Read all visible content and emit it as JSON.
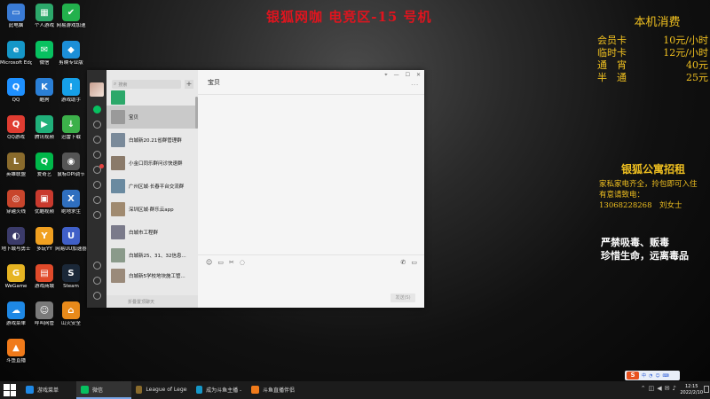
{
  "banner": "银狐网咖 电竞区-15 号机",
  "desktop_icons": [
    {
      "label": "此电脑",
      "icon": "computer-icon",
      "color": "#3a7bd5",
      "glyph": "▭"
    },
    {
      "label": "个人游戏",
      "icon": "games-folder-icon",
      "color": "#2ca86a",
      "glyph": "▦"
    },
    {
      "label": "网易游戏加速",
      "icon": "game-accelerator-icon",
      "color": "#22b14c",
      "glyph": "✔"
    },
    {
      "label": "Microsoft Edge浏览器",
      "icon": "edge-browser-icon",
      "color": "#1597c8",
      "glyph": "e"
    },
    {
      "label": "微信",
      "icon": "wechat-icon",
      "color": "#07c160",
      "glyph": "✉"
    },
    {
      "label": "剪映专业版",
      "icon": "capcut-icon",
      "color": "#1c8fd8",
      "glyph": "◆"
    },
    {
      "label": "QQ",
      "icon": "qq-icon",
      "color": "#1e90ff",
      "glyph": "Q"
    },
    {
      "label": "酷狗",
      "icon": "kugou-icon",
      "color": "#2a7fd6",
      "glyph": "K"
    },
    {
      "label": "游戏助手",
      "icon": "game-helper-icon",
      "color": "#16a0e8",
      "glyph": "!"
    },
    {
      "label": "QQ游戏",
      "icon": "qq-games-icon",
      "color": "#e03c31",
      "glyph": "Q"
    },
    {
      "label": "腾讯视频",
      "icon": "tencent-video-icon",
      "color": "#20b07a",
      "glyph": "▶"
    },
    {
      "label": "迅雷下载",
      "icon": "download-icon",
      "color": "#3cb04a",
      "glyph": "↓"
    },
    {
      "label": "英雄联盟",
      "icon": "league-of-legends-icon",
      "color": "#8a6b2c",
      "glyph": "L"
    },
    {
      "label": "爱奇艺",
      "icon": "iqiyi-icon",
      "color": "#00b84a",
      "glyph": "Q"
    },
    {
      "label": "鼠标DPI调节",
      "icon": "mouse-icon",
      "color": "#555555",
      "glyph": "◉"
    },
    {
      "label": "穿越火线",
      "icon": "crossfire-icon",
      "color": "#c8452c",
      "glyph": "◎"
    },
    {
      "label": "优酷视频",
      "icon": "youku-icon",
      "color": "#c93a2e",
      "glyph": "▣"
    },
    {
      "label": "绝地求生",
      "icon": "pubg-icon",
      "color": "#2f6fbf",
      "glyph": "X"
    },
    {
      "label": "地下城与勇士",
      "icon": "dnf-icon",
      "color": "#3b3b6a",
      "glyph": "◐"
    },
    {
      "label": "多玩YY",
      "icon": "yy-icon",
      "color": "#f0a020",
      "glyph": "Y"
    },
    {
      "label": "网易UU加速器",
      "icon": "uu-booster-icon",
      "color": "#4060c8",
      "glyph": "U"
    },
    {
      "label": "WeGame",
      "icon": "wegame-icon",
      "color": "#e6b422",
      "glyph": "G"
    },
    {
      "label": "游戏商城",
      "icon": "game-store-icon",
      "color": "#e04a2a",
      "glyph": "▤"
    },
    {
      "label": "Steam",
      "icon": "steam-icon",
      "color": "#1b2838",
      "glyph": "S"
    },
    {
      "label": "游戏菜单",
      "icon": "game-menu-icon",
      "color": "#1e88e5",
      "glyph": "☁"
    },
    {
      "label": "呼叫网管",
      "icon": "call-admin-icon",
      "color": "#7a7a7a",
      "glyph": "☺"
    },
    {
      "label": "山火安全",
      "icon": "security-icon",
      "color": "#e88a1a",
      "glyph": "⌂"
    },
    {
      "label": "斗鱼直播",
      "icon": "douyu-icon",
      "color": "#f07a1a",
      "glyph": "▲"
    }
  ],
  "pricing": {
    "title": "本机消费",
    "rows": [
      {
        "name": "会员卡",
        "price": "10元/小时"
      },
      {
        "name": "临时卡",
        "price": "12元/小时"
      },
      {
        "name": "通　宵",
        "price": "40元"
      },
      {
        "name": "半　通",
        "price": "25元"
      }
    ]
  },
  "rent": {
    "title": "银狐公寓招租",
    "lines": [
      "家私家电齐全，拎包即可入住",
      "有意请致电：",
      "13068228268　刘女士"
    ]
  },
  "warning": [
    "严禁吸毒、贩毒",
    "珍惜生命，远离毒品"
  ],
  "wechat": {
    "search_placeholder": "搜索",
    "add_label": "+",
    "conversations": [
      {
        "name": "",
        "time": "",
        "color": "#2ca86a"
      },
      {
        "name": "宝贝",
        "time": "",
        "color": "#9a9a9a"
      },
      {
        "name": "白城新20.21省群管理群",
        "time": "",
        "color": "#7a8a9a"
      },
      {
        "name": "小金口同乐群问诊快速群",
        "time": "",
        "color": "#8a7a6a"
      },
      {
        "name": "广州区城·长春平台交流群",
        "time": "",
        "color": "#6a8aa0"
      },
      {
        "name": "深圳区城·群乐云app",
        "time": "",
        "color": "#a08a70"
      },
      {
        "name": "白城市工程群",
        "time": "",
        "color": "#7a7a8a"
      },
      {
        "name": "白城新25、31、32信息...",
        "time": "",
        "color": "#8a9a8a"
      },
      {
        "name": "白城新5学校地块施工管...",
        "time": "",
        "color": "#9a8a7a"
      }
    ],
    "folded_label": "折叠置顶聊天",
    "chat_title": "宝贝",
    "more_label": "···",
    "send_label": "发送(S)",
    "window_controls": [
      "⌖",
      "—",
      "☐",
      "✕"
    ]
  },
  "ime": {
    "logo": "S",
    "labels": [
      "中",
      "◔",
      "☺",
      "⌨"
    ]
  },
  "taskbar": {
    "items": [
      {
        "label": "游戏菜单",
        "color": "#1e88e5",
        "active": false
      },
      {
        "label": "微信",
        "color": "#07c160",
        "active": true
      },
      {
        "label": "League of Legends",
        "color": "#8a6b2c",
        "active": false
      },
      {
        "label": "成为斗鱼主播 - S...",
        "color": "#1597c8",
        "active": false
      },
      {
        "label": "斗鱼直播伴侣",
        "color": "#f07a1a",
        "active": false
      }
    ],
    "time": "12:15",
    "date": "2022/2/10"
  }
}
